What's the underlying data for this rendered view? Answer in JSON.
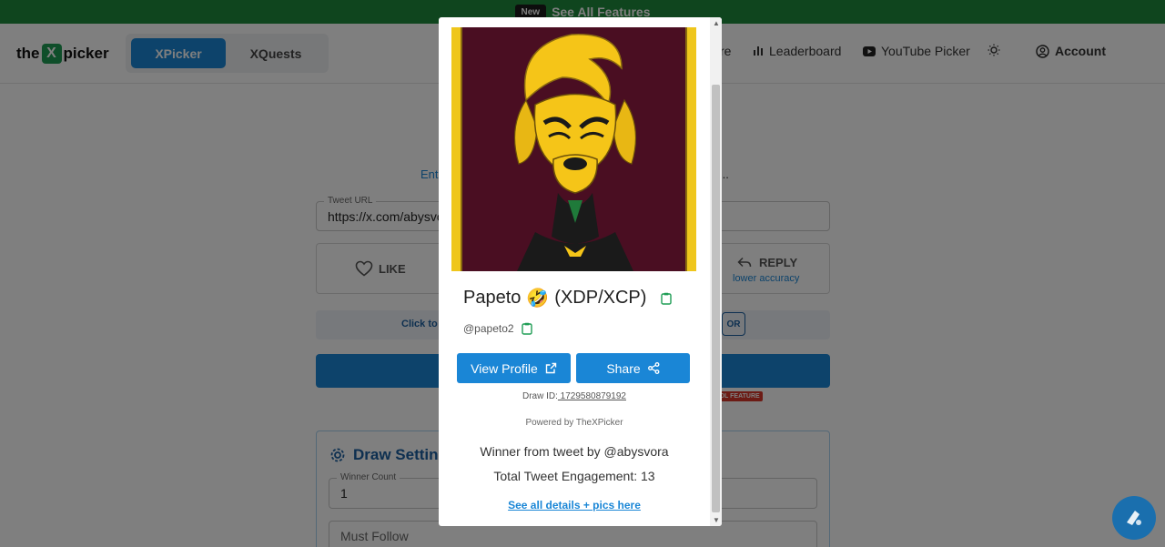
{
  "banner": {
    "badge": "New",
    "link": "See All Features"
  },
  "header": {
    "logo": {
      "pre": "the",
      "mark": "X",
      "post": "picker"
    },
    "tabs": [
      {
        "label": "XPicker",
        "active": true
      },
      {
        "label": "XQuests",
        "active": false
      }
    ],
    "nav": {
      "partial_label": "re",
      "leaderboard": "Leaderboard",
      "youtube": "YouTube Picker",
      "account": "Account"
    }
  },
  "main": {
    "subtitle_left": "Ent",
    "subtitle_right": "...",
    "tweet_url": {
      "label": "Tweet URL",
      "value": "https://x.com/abysvo"
    },
    "like_label": "LIKE",
    "reply_label": "REPLY",
    "reply_sub": "lower accuracy",
    "click_text": "Click to",
    "or_label": "OR",
    "feature_tag": "DL FEATURE",
    "draw_settings": {
      "title": "Draw Settin",
      "winner_count_label": "Winner Count",
      "winner_count_value": "1",
      "must_follow_placeholder": "Must Follow"
    }
  },
  "modal": {
    "name": "Papeto",
    "emoji": "🤣",
    "ticker": "(XDP/XCP)",
    "handle": "@papeto2",
    "view_profile": "View Profile",
    "share": "Share",
    "draw_id_label": "Draw ID:",
    "draw_id_value": " 1729580879192",
    "powered_by": "Powered by TheXPicker",
    "winner_text": "Winner from tweet by @abysvora",
    "engagement_text": "Total Tweet Engagement: 13",
    "details_link": "See all details + pics here"
  },
  "colors": {
    "brand_blue": "#1a86d6",
    "banner_green": "#1f8a3c",
    "logo_green": "#1f9d55",
    "tag_red": "#d9362a"
  }
}
